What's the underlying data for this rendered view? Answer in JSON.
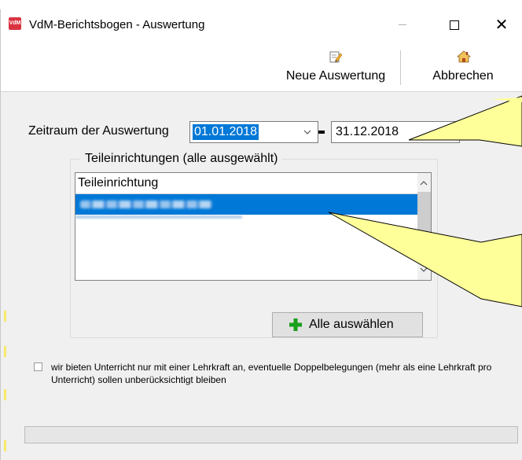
{
  "window": {
    "title": "VdM-Berichtsbogen - Auswertung",
    "app_icon_text": "VdM",
    "controls": {
      "minimize": "minimize",
      "maximize": "maximize",
      "close": "✕"
    }
  },
  "toolbar": {
    "new_label": "Neue Auswertung",
    "cancel_label": "Abbrechen"
  },
  "period": {
    "label": "Zeitraum der Auswertung",
    "from": "01.01.2018",
    "to": "31.12.2018"
  },
  "subunits": {
    "group_title": "Teileinrichtungen (alle ausgewählt)",
    "column_header": "Teileinrichtung",
    "select_all_label": "Alle auswählen"
  },
  "option": {
    "checkbox_text": "wir bieten Unterricht nur mit einer Lehrkraft an, eventuelle Doppelbelegungen (mehr als eine Lehrkraft pro Unterricht) sollen unberücksichtigt bleiben",
    "checked": false
  },
  "colors": {
    "selection": "#0078d7",
    "callout_fill": "#ffff99",
    "plus_icon": "#1aa01a"
  }
}
